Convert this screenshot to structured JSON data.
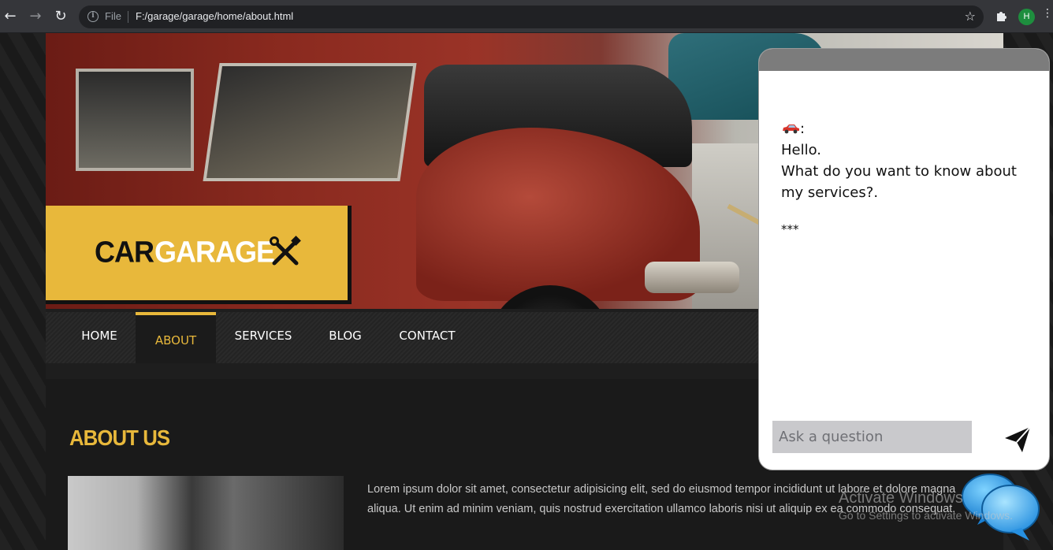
{
  "browser": {
    "file_label": "File",
    "url": "F:/garage/garage/home/about.html",
    "avatar_letter": "H"
  },
  "logo": {
    "word1": "CAR",
    "word2": "GARAGE"
  },
  "nav": {
    "items": [
      {
        "label": "HOME",
        "active": false
      },
      {
        "label": "ABOUT",
        "active": true
      },
      {
        "label": "SERVICES",
        "active": false
      },
      {
        "label": "BLOG",
        "active": false
      },
      {
        "label": "CONTACT",
        "active": false
      }
    ]
  },
  "about": {
    "title": "ABOUT US",
    "paragraph": "Lorem ipsum dolor sit amet, consectetur adipisicing elit, sed do eiusmod tempor incididunt ut labore et dolore magna aliqua. Ut enim ad minim veniam, quis nostrud exercitation ullamco laboris nisi ut aliquip ex ea commodo consequat."
  },
  "chat": {
    "sender_suffix": ":",
    "greeting": "Hello.",
    "question": "What do you want to know about my services?.",
    "separator": "***",
    "input_placeholder": "Ask a question"
  },
  "watermark": {
    "title": "Activate Windows",
    "subtitle": "Go to Settings to activate Windows."
  },
  "colors": {
    "accent": "#e8b83b",
    "nav_bg": "#2a2a2a",
    "chat_header": "#7c7c7c"
  }
}
